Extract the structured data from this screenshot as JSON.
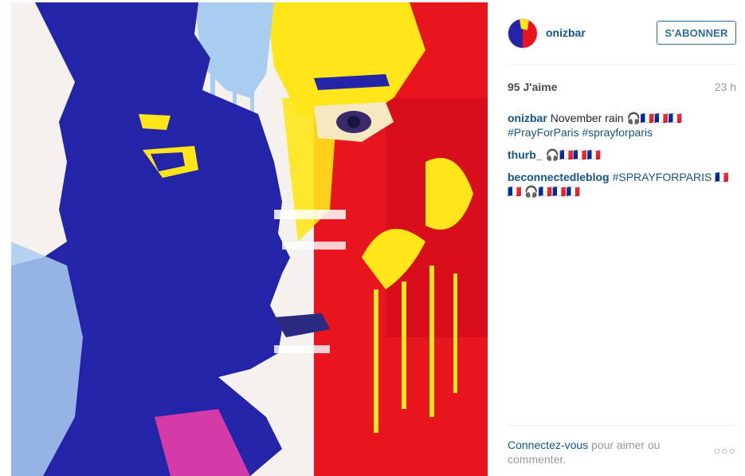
{
  "post": {
    "username": "onizbar",
    "follow_label": "S'ABONNER",
    "likes": "95 J'aime",
    "time": "23 h",
    "comments": [
      {
        "user": "onizbar",
        "text": "November rain 🎧🇫🇷🇫🇷🇫🇷",
        "tags": "#PrayForParis #sprayforparis"
      },
      {
        "user": "thurb_",
        "text": "🎧🇫🇷🇫🇷🇫🇷",
        "tags": ""
      },
      {
        "user": "beconnectedleblog",
        "text": "",
        "tags": "#SPRAYFORPARIS 🇫🇷🇫🇷 🎧🇫🇷🇫🇷🇫🇷"
      }
    ],
    "footer": {
      "login_link": "Connectez-vous",
      "rest": " pour aimer ou commenter."
    },
    "more_label": "○○○"
  },
  "colors": {
    "link": "#125688",
    "follow_border": "#2f6b9b",
    "painting_blue": "#2424a8",
    "painting_yellow": "#ffe51a",
    "painting_red": "#e8151f"
  }
}
